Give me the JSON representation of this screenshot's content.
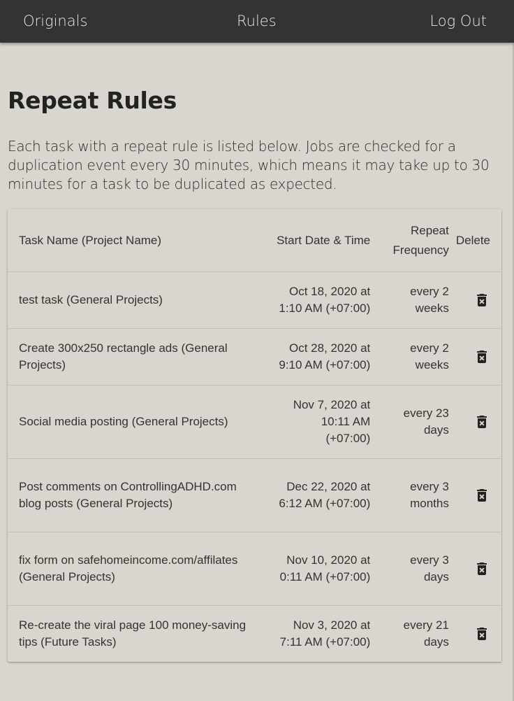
{
  "nav": {
    "originals": "Originals",
    "rules": "Rules",
    "logout": "Log Out"
  },
  "page": {
    "title": "Repeat Rules",
    "intro": "Each task with a repeat rule is listed below. Jobs are checked for a duplication event every 30 minutes, which means it may take up to 30 minutes for a task to be duplicated as expected."
  },
  "table": {
    "headers": {
      "task": "Task Name (Project Name)",
      "start": "Start Date & Time",
      "frequency_line1": "Repeat",
      "frequency_line2": "Frequency",
      "delete": "Delete"
    },
    "rows": [
      {
        "task": "test task (General Projects)",
        "start_line1": "Oct 18, 2020 at",
        "start_line2": "1:10 AM (+07:00)",
        "freq_line1": "every 2",
        "freq_line2": "weeks"
      },
      {
        "task": "Create 300x250 rectangle ads (General Projects)",
        "start_line1": "Oct 28, 2020 at",
        "start_line2": "9:10 AM (+07:00)",
        "freq_line1": "every 2",
        "freq_line2": "weeks"
      },
      {
        "task": "Social media posting (General Projects)",
        "start_line1": "Nov 7, 2020 at",
        "start_line2": "10:11 AM",
        "start_line3": "(+07:00)",
        "freq_line1": "every 23",
        "freq_line2": "days"
      },
      {
        "task": "Post comments on ControllingADHD.com blog posts (General Projects)",
        "start_line1": "Dec 22, 2020 at",
        "start_line2": "6:12 AM (+07:00)",
        "freq_line1": "every 3",
        "freq_line2": "months"
      },
      {
        "task": "fix form on safehomeincome.com/affilates (General Projects)",
        "start_line1": "Nov 10, 2020 at",
        "start_line2": "0:11 AM (+07:00)",
        "freq_line1": "every 3",
        "freq_line2": "days"
      },
      {
        "task": "Re-create the viral page 100 money-saving tips  (Future Tasks)",
        "start_line1": "Nov 3, 2020 at",
        "start_line2": "7:11 AM (+07:00)",
        "freq_line1": "every 21",
        "freq_line2": "days"
      }
    ]
  },
  "icons": {
    "delete": "delete-forever-icon"
  },
  "colors": {
    "topbar": "#333333",
    "background": "#d9d6cf",
    "nav_text": "#e6e6e6"
  }
}
